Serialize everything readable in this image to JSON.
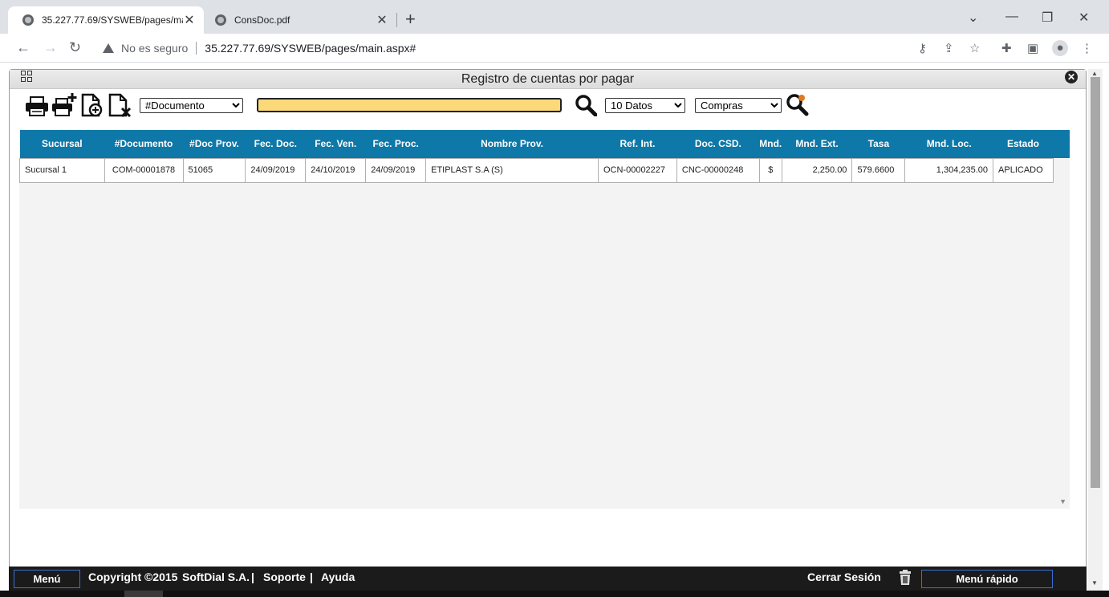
{
  "browser": {
    "tabs": [
      {
        "title": "35.227.77.69/SYSWEB/pages/main.aspx",
        "active": true
      },
      {
        "title": "ConsDoc.pdf",
        "active": false
      }
    ],
    "new_tab_symbol": "+",
    "security_label": "No es seguro",
    "url": "35.227.77.69/SYSWEB/pages/main.aspx#"
  },
  "window": {
    "title": "Registro de cuentas por pagar"
  },
  "toolbar": {
    "filter_field": {
      "selected": "#Documento",
      "options": [
        "#Documento"
      ]
    },
    "search_value": "",
    "page_size": {
      "selected": "10 Datos",
      "options": [
        "10 Datos"
      ]
    },
    "module": {
      "selected": "Compras",
      "options": [
        "Compras"
      ]
    },
    "icons": [
      "print-icon",
      "print-add-icon",
      "new-document-icon",
      "delete-document-icon",
      "search-icon",
      "advanced-search-icon"
    ]
  },
  "table": {
    "columns": [
      "Sucursal",
      "#Documento",
      "#Doc Prov.",
      "Fec. Doc.",
      "Fec. Ven.",
      "Fec. Proc.",
      "Nombre Prov.",
      "Ref. Int.",
      "Doc. CSD.",
      "Mnd.",
      "Mnd. Ext.",
      "Tasa",
      "Mnd. Loc.",
      "Estado"
    ],
    "rows": [
      [
        "Sucursal 1",
        "COM-00001878",
        "51065",
        "24/09/2019",
        "24/10/2019",
        "24/09/2019",
        "ETIPLAST S.A (S)",
        "OCN-00002227",
        "CNC-00000248",
        "$",
        "2,250.00",
        "579.6600",
        "1,304,235.00",
        "APLICADO"
      ]
    ]
  },
  "footer": {
    "menu_label": "Menú",
    "copyright": "Copyright ©2015",
    "company": "SoftDial S.A.",
    "support": "Soporte",
    "help": "Ayuda",
    "separator": "|",
    "logout": "Cerrar Sesión",
    "quick_menu": "Menú rápido"
  },
  "colors": {
    "header_bg": "#0e78a8",
    "search_bg": "#fbd978",
    "footer_bg": "#1b1b1b",
    "button_border": "#3b6ed6"
  }
}
